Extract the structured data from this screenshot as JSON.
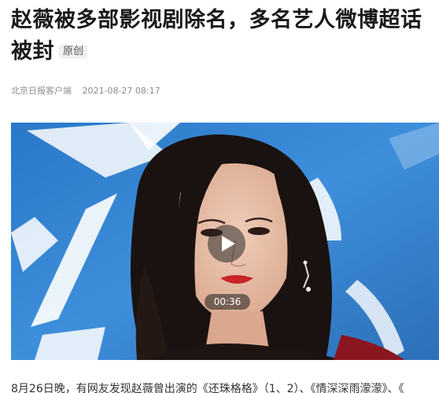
{
  "article": {
    "title_line1": "赵薇被多部影视剧除名，多名艺人微博超话",
    "title_line2": "被封",
    "badge": "原创",
    "source": "北京日报客户端",
    "date": "2021-08-27 08:17"
  },
  "video": {
    "duration": "00:36",
    "play_icon": "play-icon"
  },
  "body": {
    "paragraph": "8月26日晚，有网友发现赵薇曾出演的《还珠格格》（1、2）、《情深深雨濛濛》、《"
  },
  "colors": {
    "title": "#191919",
    "meta": "#8c8c8c",
    "badge_bg": "#f0f0f0",
    "video_bg": "#2f7fd0"
  }
}
